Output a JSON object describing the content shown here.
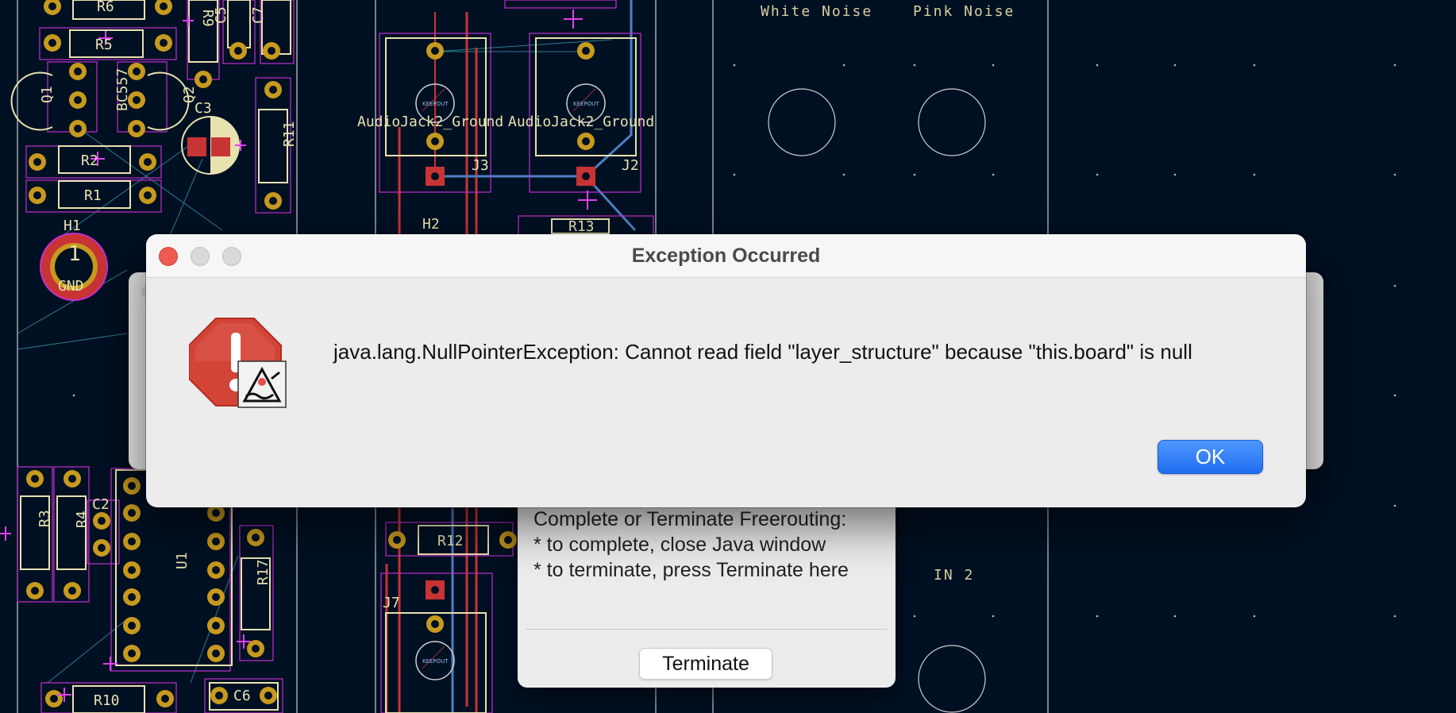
{
  "pcb": {
    "panel_labels": [
      "White Noise",
      "Pink Noise",
      "IN 2"
    ],
    "refs": [
      "R6",
      "R5",
      "R9",
      "C5",
      "C7",
      "Q1",
      "BC557",
      "Q2",
      "C3",
      "R11",
      "R2",
      "R1",
      "H1",
      "GND",
      "AudioJack2_Ground",
      "AudioJack2_Ground",
      "J3",
      "J2",
      "J7",
      "H2",
      "R12",
      "R3",
      "R4",
      "C2",
      "U1",
      "R17",
      "R10",
      "C6",
      "R13",
      "1"
    ],
    "keepout_label": "KEEPOUT"
  },
  "dialog": {
    "title": "Exception Occurred",
    "message": "java.lang.NullPointerException: Cannot read field \"layer_structure\" because \"this.board\" is null",
    "ok_label": "OK"
  },
  "freerouting": {
    "line1": "Complete or Terminate Freerouting:",
    "line2": "* to complete, close Java window",
    "line3": "* to terminate, press Terminate here",
    "terminate_label": "Terminate"
  },
  "colors": {
    "board_bg": "#001023",
    "silkscreen": "#e8e2b0",
    "courtyard": "#c22fd0",
    "copper_front": "#c83434",
    "copper_back": "#4d7fc4",
    "pad": "#c79a1e",
    "accent": "#1f6df0"
  }
}
